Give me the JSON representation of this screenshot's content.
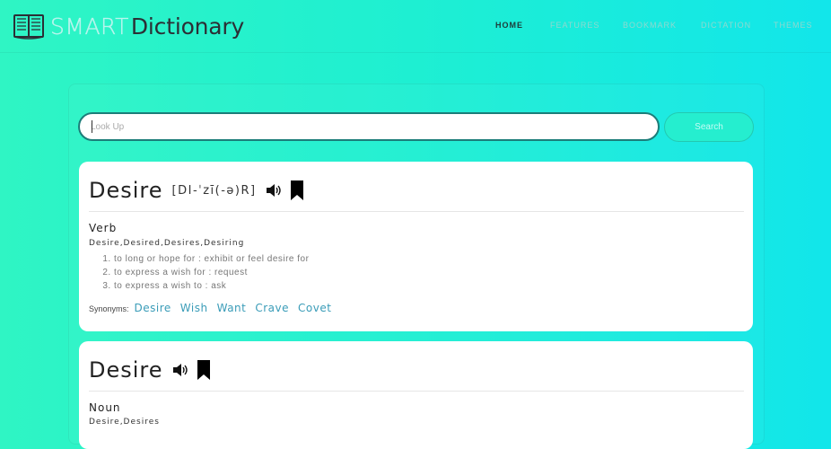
{
  "brand": {
    "smart": "SMART",
    "dictionary": "Dictionary"
  },
  "nav": {
    "home": "HOME",
    "features": "FEATURES",
    "bookmark": "BOOKMARK",
    "dictation": "DICTATION",
    "themes": "THEMES"
  },
  "search": {
    "placeholder": "Look Up",
    "button": "Search"
  },
  "entries": [
    {
      "word": "Desire",
      "phonetic": "[DI-ˈzī(-ə)R]",
      "pos": "Verb",
      "forms": "Desire,Desired,Desires,Desiring",
      "definitions": [
        "to long or hope for : exhibit or feel desire for",
        "to express a wish for : request",
        "to express a wish to : ask"
      ],
      "synonyms_label": "Synonyms:",
      "synonyms": [
        "Desire",
        "Wish",
        "Want",
        "Crave",
        "Covet"
      ]
    },
    {
      "word": "Desire",
      "pos": "Noun",
      "forms": "Desire,Desires"
    }
  ],
  "colors": {
    "accent": "#25eecf",
    "link": "#3a9cb8",
    "input_border": "#1c7d79"
  },
  "icons": [
    "book-logo-icon",
    "speaker-icon",
    "bookmark-icon"
  ]
}
